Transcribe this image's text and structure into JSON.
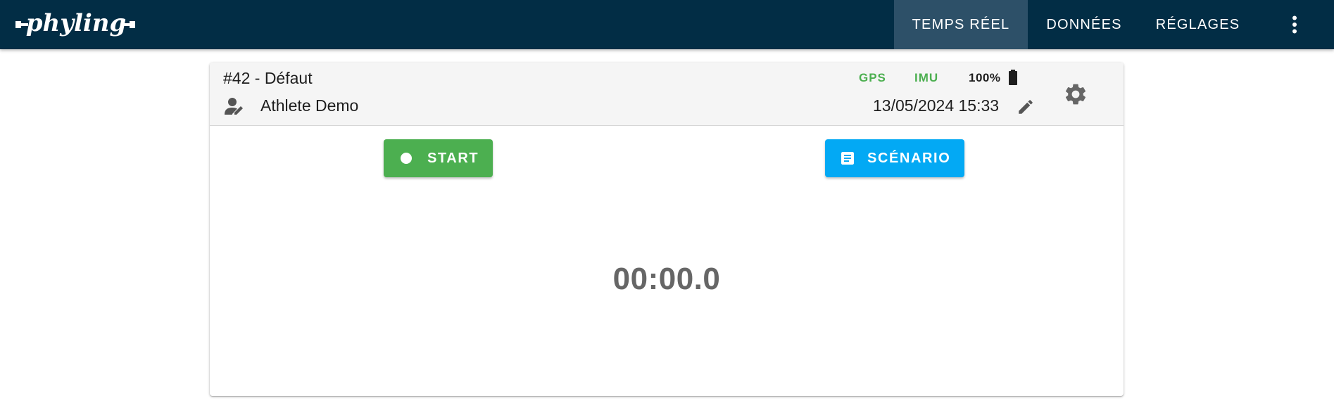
{
  "app": {
    "logo_text": "phyling"
  },
  "nav": {
    "tabs": [
      {
        "label": "TEMPS RÉEL",
        "active": true
      },
      {
        "label": "DONNÉES",
        "active": false
      },
      {
        "label": "RÉGLAGES",
        "active": false
      }
    ],
    "menu_icon": "more-vert-icon"
  },
  "session": {
    "title": "#42 - Défaut",
    "athlete_name": "Athlete Demo",
    "athlete_icon": "person-edit-icon",
    "status": {
      "gps_label": "GPS",
      "imu_label": "IMU",
      "battery": "100%",
      "battery_icon": "battery-full-icon"
    },
    "datetime": "13/05/2024 15:33",
    "edit_icon": "pencil-icon",
    "settings_icon": "gear-icon"
  },
  "actions": {
    "start_label": "START",
    "start_icon": "record-dot-icon",
    "scenario_label": "SCÉNARIO",
    "scenario_icon": "document-icon"
  },
  "timer": {
    "value": "00:00.0"
  },
  "colors": {
    "appbar": "#022d45",
    "active_tab": "#2d5068",
    "status_ok": "#4caf50",
    "start_button": "#4caf50",
    "scenario_button": "#03a9f4",
    "timer_text": "#666666"
  }
}
